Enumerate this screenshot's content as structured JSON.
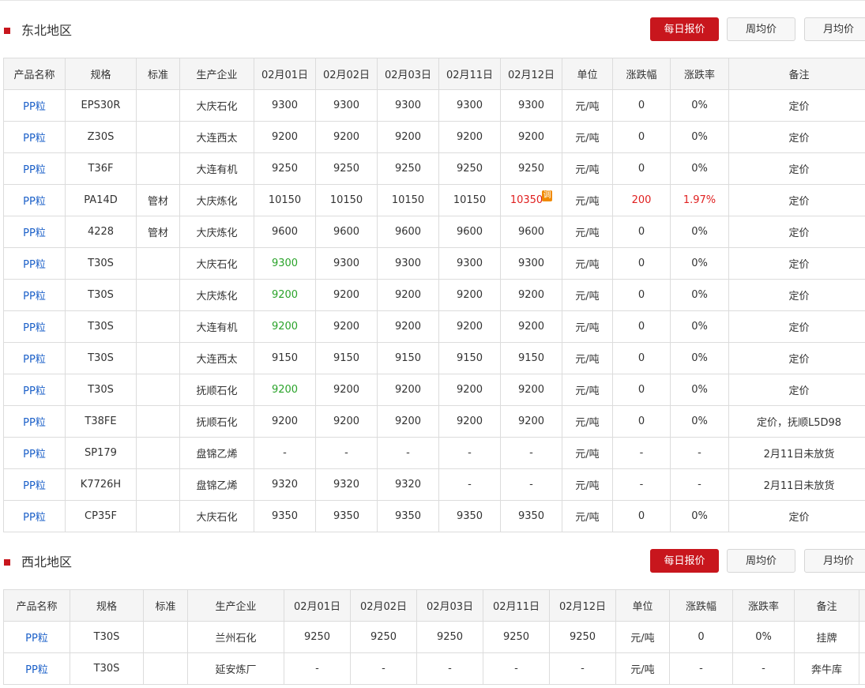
{
  "sections": [
    {
      "title": "东北地区",
      "buttons": [
        "每日报价",
        "周均价",
        "月均价"
      ],
      "headers": [
        "产品名称",
        "规格",
        "标准",
        "生产企业",
        "02月01日",
        "02月02日",
        "02月03日",
        "02月11日",
        "02月12日",
        "单位",
        "涨跌幅",
        "涨跌率",
        "备注"
      ],
      "rows": [
        [
          "PP粒",
          "EPS30R",
          "",
          "大庆石化",
          "9300",
          "9300",
          "9300",
          "9300",
          "9300",
          "元/吨",
          "0",
          "0%",
          "定价"
        ],
        [
          "PP粒",
          "Z30S",
          "",
          "大连西太",
          "9200",
          "9200",
          "9200",
          "9200",
          "9200",
          "元/吨",
          "0",
          "0%",
          "定价"
        ],
        [
          "PP粒",
          "T36F",
          "",
          "大连有机",
          "9250",
          "9250",
          "9250",
          "9250",
          "9250",
          "元/吨",
          "0",
          "0%",
          "定价"
        ],
        [
          "PP粒",
          "PA14D",
          "管材",
          "大庆炼化",
          "10150",
          "10150",
          "10150",
          "10150",
          "10350",
          "元/吨",
          "200",
          "1.97%",
          "定价"
        ],
        [
          "PP粒",
          "4228",
          "管材",
          "大庆炼化",
          "9600",
          "9600",
          "9600",
          "9600",
          "9600",
          "元/吨",
          "0",
          "0%",
          "定价"
        ],
        [
          "PP粒",
          "T30S",
          "",
          "大庆石化",
          "9300",
          "9300",
          "9300",
          "9300",
          "9300",
          "元/吨",
          "0",
          "0%",
          "定价"
        ],
        [
          "PP粒",
          "T30S",
          "",
          "大庆炼化",
          "9200",
          "9200",
          "9200",
          "9200",
          "9200",
          "元/吨",
          "0",
          "0%",
          "定价"
        ],
        [
          "PP粒",
          "T30S",
          "",
          "大连有机",
          "9200",
          "9200",
          "9200",
          "9200",
          "9200",
          "元/吨",
          "0",
          "0%",
          "定价"
        ],
        [
          "PP粒",
          "T30S",
          "",
          "大连西太",
          "9150",
          "9150",
          "9150",
          "9150",
          "9150",
          "元/吨",
          "0",
          "0%",
          "定价"
        ],
        [
          "PP粒",
          "T30S",
          "",
          "抚顺石化",
          "9200",
          "9200",
          "9200",
          "9200",
          "9200",
          "元/吨",
          "0",
          "0%",
          "定价"
        ],
        [
          "PP粒",
          "T38FE",
          "",
          "抚顺石化",
          "9200",
          "9200",
          "9200",
          "9200",
          "9200",
          "元/吨",
          "0",
          "0%",
          "定价，抚顺L5D98"
        ],
        [
          "PP粒",
          "SP179",
          "",
          "盘锦乙烯",
          "-",
          "-",
          "-",
          "-",
          "-",
          "元/吨",
          "-",
          "-",
          "2月11日未放货"
        ],
        [
          "PP粒",
          "K7726H",
          "",
          "盘锦乙烯",
          "9320",
          "9320",
          "9320",
          "-",
          "-",
          "元/吨",
          "-",
          "-",
          "2月11日未放货"
        ],
        [
          "PP粒",
          "CP35F",
          "",
          "大庆石化",
          "9350",
          "9350",
          "9350",
          "9350",
          "9350",
          "元/吨",
          "0",
          "0%",
          "定价"
        ]
      ],
      "adjust_badge": "调"
    },
    {
      "title": "西北地区",
      "buttons": [
        "每日报价",
        "周均价",
        "月均价"
      ],
      "headers": [
        "产品名称",
        "规格",
        "标准",
        "生产企业",
        "02月01日",
        "02月02日",
        "02月03日",
        "02月11日",
        "02月12日",
        "单位",
        "涨跌幅",
        "涨跌率",
        "备注"
      ],
      "rows": [
        [
          "PP粒",
          "T30S",
          "",
          "兰州石化",
          "9250",
          "9250",
          "9250",
          "9250",
          "9250",
          "元/吨",
          "0",
          "0%",
          "挂牌"
        ],
        [
          "PP粒",
          "T30S",
          "",
          "延安炼厂",
          "-",
          "-",
          "-",
          "-",
          "-",
          "元/吨",
          "-",
          "-",
          "奔牛库"
        ]
      ]
    }
  ],
  "colors": {
    "accent": "#c8161d",
    "link": "#1a5fc8",
    "up": "#e02020",
    "green": "#2aa32a",
    "badge": "#f08a00"
  }
}
